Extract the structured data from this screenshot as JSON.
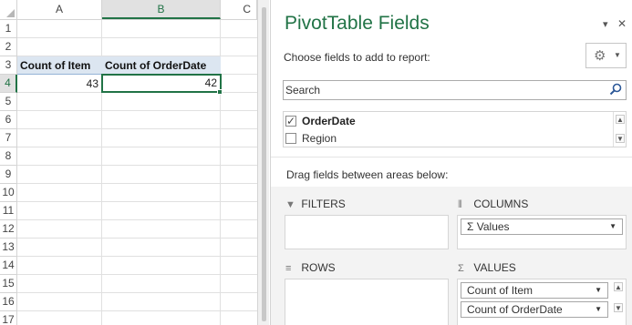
{
  "sheet": {
    "columns": [
      "A",
      "B",
      "C"
    ],
    "rows": [
      "1",
      "2",
      "3",
      "4",
      "5",
      "6",
      "7",
      "8",
      "9",
      "10",
      "11",
      "12",
      "13",
      "14",
      "15",
      "16",
      "17"
    ],
    "selected_column": "B",
    "selected_row": "4",
    "pivot": {
      "header_a": "Count of Item",
      "header_b": "Count of OrderDate",
      "value_a": "43",
      "value_b": "42"
    }
  },
  "pane": {
    "title": "PivotTable Fields",
    "dropdown_glyph": "▾",
    "close_glyph": "✕",
    "choose_label": "Choose fields to add to report:",
    "gear_icon": "gear-icon",
    "search_placeholder": "Search",
    "fields": [
      {
        "label": "OrderDate",
        "checked": true
      },
      {
        "label": "Region",
        "checked": false
      }
    ],
    "drag_label": "Drag fields between areas below:",
    "areas": {
      "filters": {
        "label": "FILTERS",
        "icon": "filter-icon"
      },
      "columns": {
        "label": "COLUMNS",
        "icon": "columns-icon",
        "items": [
          "Σ  Values"
        ]
      },
      "rows": {
        "label": "ROWS",
        "icon": "rows-icon"
      },
      "values": {
        "label": "VALUES",
        "icon": "sigma-icon",
        "items": [
          "Count of Item",
          "Count of OrderDate"
        ]
      }
    },
    "colors": {
      "accent": "#217346",
      "pivot_header": "#dce6f1"
    }
  }
}
